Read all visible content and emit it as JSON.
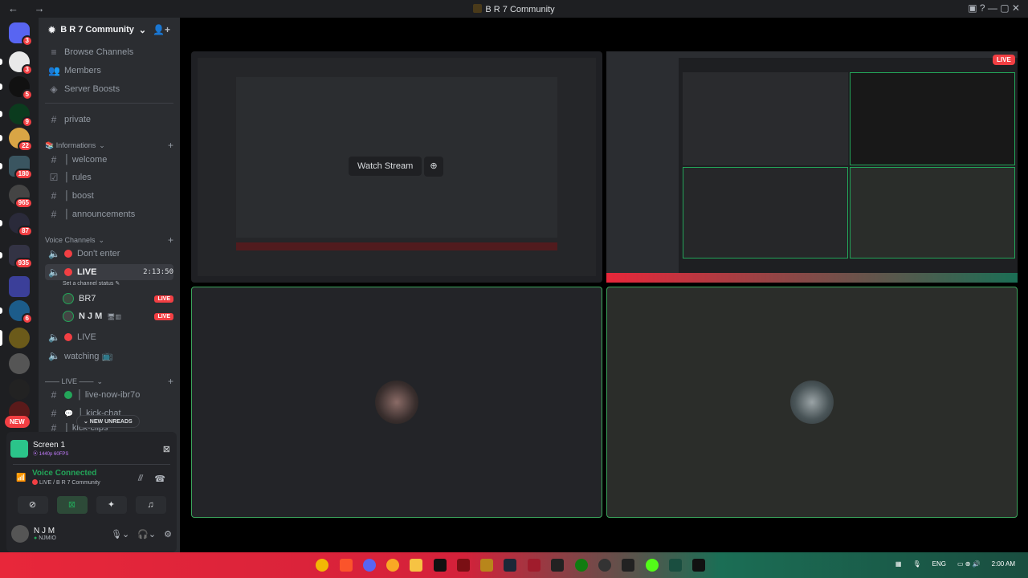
{
  "window": {
    "nav_arrows": "← →",
    "title": "B R 7 Community",
    "right_icons": "▣ ? — ▢ ✕"
  },
  "guilds": [
    {
      "badge": "3",
      "selected": false
    },
    {
      "badge": "3",
      "selected": false
    },
    {
      "badge": "5",
      "selected": false
    },
    {
      "badge": "9",
      "selected": false
    },
    {
      "badge": "22",
      "selected": false
    },
    {
      "badge": "180",
      "selected": false
    },
    {
      "badge": "965",
      "selected": false
    },
    {
      "badge": "87",
      "selected": false
    },
    {
      "badge": "935",
      "selected": false
    },
    {
      "badge": "",
      "selected": false
    },
    {
      "badge": "6",
      "selected": false
    },
    {
      "badge": "",
      "selected": true
    },
    {
      "badge": "",
      "selected": false
    },
    {
      "badge": "",
      "selected": false
    },
    {
      "badge": "",
      "selected": false
    }
  ],
  "new_pill": "NEW",
  "server": {
    "name": "B R 7 Community",
    "chevron": "⌄",
    "nav": [
      {
        "icon": "≡",
        "label": "Browse Channels"
      },
      {
        "icon": "👥",
        "label": "Members"
      },
      {
        "icon": "◈",
        "label": "Server Boosts"
      }
    ],
    "private_channel": "private",
    "categories": {
      "informations": "📚 Informations",
      "voice": "Voice Channels",
      "live": "—— LIVE ——"
    },
    "info_channels": [
      {
        "icon": "#",
        "label": "│ welcome"
      },
      {
        "icon": "☑",
        "label": "│ rules"
      },
      {
        "icon": "#",
        "label": "│ boost"
      },
      {
        "icon": "#",
        "label": "│ announcements"
      }
    ],
    "voice_channels": {
      "dont_enter": "Don't enter",
      "live": "LIVE",
      "live_timer": "2:13:50",
      "live_status": "Set a channel status ✎",
      "members": [
        {
          "name": "BR7",
          "badge": "LIVE"
        },
        {
          "name": "N J M",
          "badge": "LIVE"
        }
      ],
      "live2": "LIVE",
      "watching": "watching 📺"
    },
    "live_channels": [
      {
        "label": "│ live-now-ibr7o"
      },
      {
        "label": "│ kick-chat"
      },
      {
        "label": "│ kick-clips"
      }
    ],
    "new_unreads": "⌄ NEW UNREADS"
  },
  "panel": {
    "screen_title": "Screen 1",
    "screen_sub": "⦿ 1440p 60FPS",
    "voice_state": "Voice Connected",
    "voice_where": "LIVE / B R 7 Community",
    "user_name": "N J M",
    "user_tag": "NJMIO"
  },
  "stream": {
    "watch_label": "Watch Stream",
    "live_tag": "LIVE"
  },
  "taskbar": {
    "lang": "ENG",
    "clock": "2:00 AM"
  },
  "colors": {
    "accent_green": "#23a559",
    "live_red": "#f23f43",
    "sidebar": "#2b2d31",
    "guild_bar": "#1e1f22"
  }
}
